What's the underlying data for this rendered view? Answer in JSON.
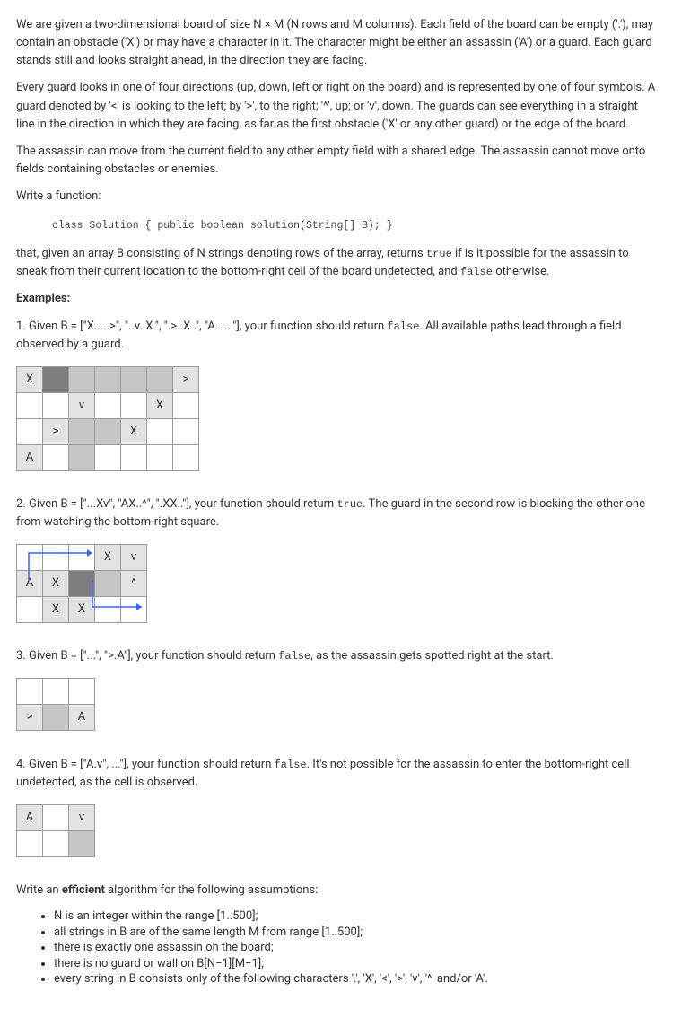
{
  "paragraphs": {
    "intro1": "We are given a two-dimensional board of size N × M (N rows and M columns). Each field of the board can be empty ('.'), may contain an obstacle ('X') or may have a character in it. The character might be either an assassin ('A') or a guard. Each guard stands still and looks straight ahead, in the direction they are facing.",
    "intro2": "Every guard looks in one of four directions (up, down, left or right on the board) and is represented by one of four symbols. A guard denoted by '<' is looking to the left; by '>', to the right; '^', up; or 'v', down. The guards can see everything in a straight line in the direction in which they are facing, as far as the first obstacle ('X' or any other guard) or the edge of the board.",
    "intro3": "The assassin can move from the current field to any other empty field with a shared edge. The assassin cannot move onto fields containing obstacles or enemies.",
    "writeFn": "Write a function:",
    "signature": "class Solution { public boolean solution(String[] B); }",
    "task": "that, given an array B consisting of N strings denoting rows of the array, returns true if is it possible for the assassin to sneak from their current location to the bottom-right cell of the board undetected, and false otherwise.",
    "examplesTitle": "Examples:",
    "ex1": "1. Given B = [\"X.....>\", \"..v..X.\", \".>..X..\", \"A......\"], your function should return false. All available paths lead through a field observed by a guard.",
    "ex2": "2. Given B = [\"...Xv\", \"AX..^\", \".XX..\"], your function should return true. The guard in the second row is blocking the other one from watching the bottom-right square.",
    "ex3": "3. Given B = [\"...\", \">.A\"], your function should return false, as the assassin gets spotted right at the start.",
    "ex4": "4. Given B = [\"A.v\", ...\"], your function should return false. It's not possible for the assassin to enter the bottom-right cell undetected, as the cell is observed.",
    "efficient": "Write an efficient algorithm for the following assumptions:",
    "assumptions": [
      "N is an integer within the range [1..500];",
      "all strings in B are of the same length M from range [1..500];",
      "there is exactly one assassin on the board;",
      "there is no guard or wall on B[N−1][M−1];",
      "every string in B consists only of the following characters '.', 'X', '<', '>', 'v', '^' and/or 'A'."
    ]
  },
  "boards": {
    "ex1": [
      [
        {
          "c": "blocked",
          "t": "X"
        },
        {
          "c": "dark"
        },
        {
          "c": "seen"
        },
        {
          "c": "seen"
        },
        {
          "c": "seen"
        },
        {
          "c": "seen"
        },
        {
          "c": "blocked",
          "t": ">"
        }
      ],
      [
        {
          "c": ""
        },
        {
          "c": ""
        },
        {
          "c": "blocked",
          "t": "v"
        },
        {
          "c": ""
        },
        {
          "c": ""
        },
        {
          "c": "blocked",
          "t": "X"
        },
        {
          "c": ""
        }
      ],
      [
        {
          "c": ""
        },
        {
          "c": "blocked",
          "t": ">"
        },
        {
          "c": "seen"
        },
        {
          "c": "seen"
        },
        {
          "c": "blocked",
          "t": "X"
        },
        {
          "c": ""
        },
        {
          "c": ""
        }
      ],
      [
        {
          "c": "blocked",
          "t": "A"
        },
        {
          "c": ""
        },
        {
          "c": "seen"
        },
        {
          "c": ""
        },
        {
          "c": ""
        },
        {
          "c": ""
        },
        {
          "c": ""
        }
      ]
    ],
    "ex2": [
      [
        {
          "c": ""
        },
        {
          "c": ""
        },
        {
          "c": ""
        },
        {
          "c": "blocked",
          "t": "X"
        },
        {
          "c": "blocked",
          "t": "v"
        }
      ],
      [
        {
          "c": "blocked",
          "t": "A"
        },
        {
          "c": "blocked",
          "t": "X"
        },
        {
          "c": "dark"
        },
        {
          "c": "seen"
        },
        {
          "c": "blocked",
          "t": "^"
        }
      ],
      [
        {
          "c": ""
        },
        {
          "c": "blocked",
          "t": "X"
        },
        {
          "c": "blocked",
          "t": "X"
        },
        {
          "c": ""
        },
        {
          "c": ""
        }
      ]
    ],
    "ex3": [
      [
        {
          "c": ""
        },
        {
          "c": ""
        },
        {
          "c": ""
        }
      ],
      [
        {
          "c": "blocked",
          "t": ">"
        },
        {
          "c": "seen"
        },
        {
          "c": "blocked",
          "t": "A"
        }
      ]
    ],
    "ex4": [
      [
        {
          "c": "blocked",
          "t": "A"
        },
        {
          "c": ""
        },
        {
          "c": "blocked",
          "t": "v"
        }
      ],
      [
        {
          "c": ""
        },
        {
          "c": ""
        },
        {
          "c": "seen"
        }
      ]
    ]
  }
}
